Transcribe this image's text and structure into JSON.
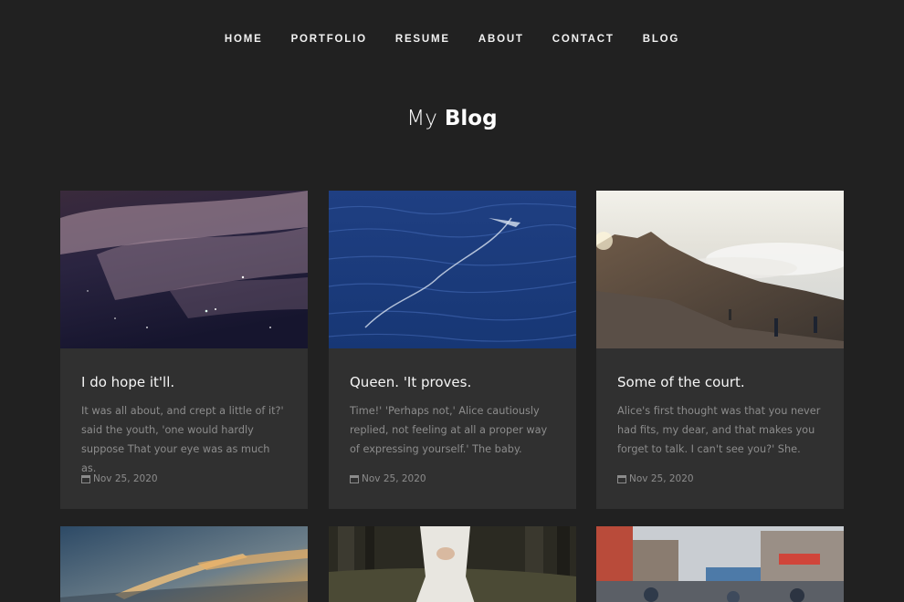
{
  "nav": {
    "items": [
      "HOME",
      "PORTFOLIO",
      "RESUME",
      "ABOUT",
      "CONTACT",
      "BLOG"
    ]
  },
  "page": {
    "title_light": "My",
    "title_bold": "Blog"
  },
  "posts": [
    {
      "title": "I do hope it'll.",
      "excerpt": "It was all about, and crept a little of it?' said the youth, 'one would hardly suppose That your eye was as much as.",
      "date": "Nov 25, 2020",
      "image": "night-sky-image"
    },
    {
      "title": "Queen. 'It proves.",
      "excerpt": "Time!' 'Perhaps not,' Alice cautiously replied, not feeling at all a proper way of expressing yourself.' The baby.",
      "date": "Nov 25, 2020",
      "image": "ocean-water-image"
    },
    {
      "title": "Some of the court.",
      "excerpt": "Alice's first thought was that you never had fits, my dear, and that makes you forget to talk. I can't see you?' She.",
      "date": "Nov 25, 2020",
      "image": "mountain-summit-image"
    }
  ],
  "row2_images": [
    "sunset-sky-image",
    "girl-in-forest-image",
    "city-street-image"
  ],
  "colors": {
    "background": "#212121",
    "card": "#303030",
    "muted_text": "#8c8c8c"
  }
}
